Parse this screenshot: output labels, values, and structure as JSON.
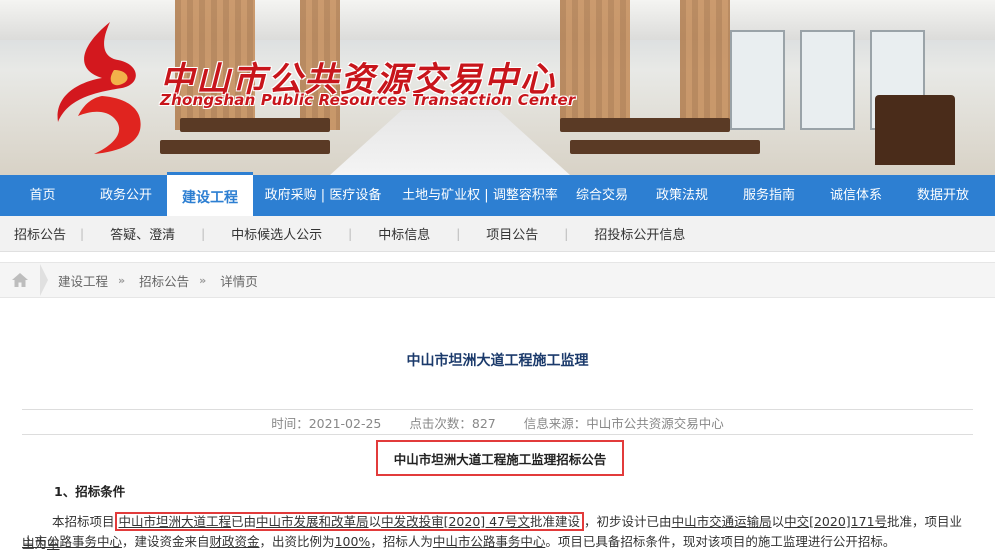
{
  "site": {
    "title_cn": "中山市公共资源交易中心",
    "title_en": "Zhongshan Public Resources Transaction Center"
  },
  "main_nav": [
    {
      "label": "首页",
      "active": false
    },
    {
      "label": "政务公开",
      "active": false
    },
    {
      "label": "建设工程",
      "active": true
    },
    {
      "label": "政府采购 | 医疗设备",
      "active": false
    },
    {
      "label": "土地与矿业权 | 调整容积率",
      "active": false
    },
    {
      "label": "综合交易",
      "active": false
    },
    {
      "label": "政策法规",
      "active": false
    },
    {
      "label": "服务指南",
      "active": false
    },
    {
      "label": "诚信体系",
      "active": false
    },
    {
      "label": "数据开放",
      "active": false
    }
  ],
  "sub_nav": [
    "招标公告",
    "答疑、澄清",
    "中标候选人公示",
    "中标信息",
    "项目公告",
    "招投标公开信息"
  ],
  "breadcrumb": [
    "建设工程",
    "招标公告",
    "详情页"
  ],
  "article": {
    "title": "中山市坦洲大道工程施工监理",
    "meta_time": "时间：2021-02-25",
    "meta_clicks": "点击次数：827",
    "meta_source": "信息来源：中山市公共资源交易中心",
    "notice_title": "中山市坦洲大道工程施工监理招标公告",
    "section1": "1、招标条件",
    "p1": {
      "t0": "本招标项目",
      "t1": "中山市坦洲大道工程",
      "t2": "已由",
      "t3": "中山市发展和改革局",
      "t4": "以",
      "t5": "中发改投审[2020] 47号文",
      "t6": "批准建设",
      "t7": "，初步设计已由",
      "t8": "中山市交通运输局",
      "t9": "以",
      "t10": "中交[2020]171号",
      "t11": "批准，项目业主为",
      "t12": "中"
    },
    "p2": {
      "t0": "山市公路事务中心",
      "t1": "，建设资金来自",
      "t2": "财政资金",
      "t3": "，出资比例为",
      "t4": "100%",
      "t5": "，招标人为",
      "t6": "中山市公路事务中心",
      "t7": "。项目已具备招标条件，现对该项目的施工监理进行公开招标。"
    }
  },
  "colors": {
    "nav_blue": "#2d7fd2",
    "brand_red": "#c8151b",
    "highlight_red": "#e23b3b"
  }
}
